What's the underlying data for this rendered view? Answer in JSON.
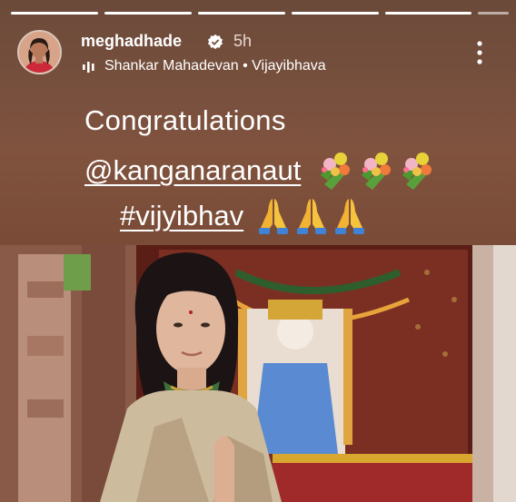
{
  "story": {
    "progress_segments": 6,
    "completed_segments": 5
  },
  "header": {
    "username": "meghadhade",
    "verified_icon": "verified-badge-icon",
    "time": "5h",
    "music": "Shankar Mahadevan • Vijayibhava",
    "music_icon": "music-bars-icon",
    "more_icon": "more-vertical-icon"
  },
  "caption": {
    "line1": "Congratulations",
    "mention": "@kanganaranaut",
    "hashtag": "#vijyibhav",
    "bouquet_emoji": "bouquet",
    "prayer_emoji": "folded-hands"
  },
  "colors": {
    "background_top": "#6b4a3a",
    "background_mid": "#80533f",
    "text": "#ffffff"
  }
}
